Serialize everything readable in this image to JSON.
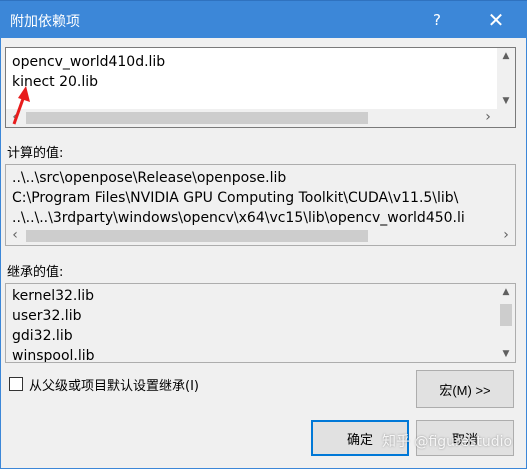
{
  "window": {
    "title": "附加依赖项",
    "help_label": "?",
    "close_label": "✕"
  },
  "editor": {
    "lines": [
      "opencv_world410d.lib",
      "kinect 20.lib"
    ]
  },
  "evaluated": {
    "label": "计算的值:",
    "lines": [
      "..\\..\\src\\openpose\\Release\\openpose.lib",
      "C:\\Program Files\\NVIDIA GPU Computing Toolkit\\CUDA\\v11.5\\lib\\",
      "..\\..\\..\\3rdparty\\windows\\opencv\\x64\\vc15\\lib\\opencv_world450.li"
    ]
  },
  "inherited": {
    "label": "继承的值:",
    "lines": [
      "kernel32.lib",
      "user32.lib",
      "gdi32.lib",
      "winspool.lib"
    ]
  },
  "inherit_checkbox": {
    "label": "从父级或项目默认设置继承(I)",
    "checked": false
  },
  "buttons": {
    "macro": "宏(M) >>",
    "ok": "确定",
    "cancel": "取消"
  },
  "watermark": "知乎 @figurestudio",
  "icons": {
    "scroll_up": "triangle-up-icon",
    "scroll_down": "triangle-down-icon",
    "scroll_left": "chevron-left-icon",
    "scroll_right": "chevron-right-icon",
    "annotation": "red-arrow-icon"
  },
  "colors": {
    "titlebar": "#3c87d8",
    "default_button_border": "#0078d7",
    "annotation_arrow": "#e81c1c"
  }
}
